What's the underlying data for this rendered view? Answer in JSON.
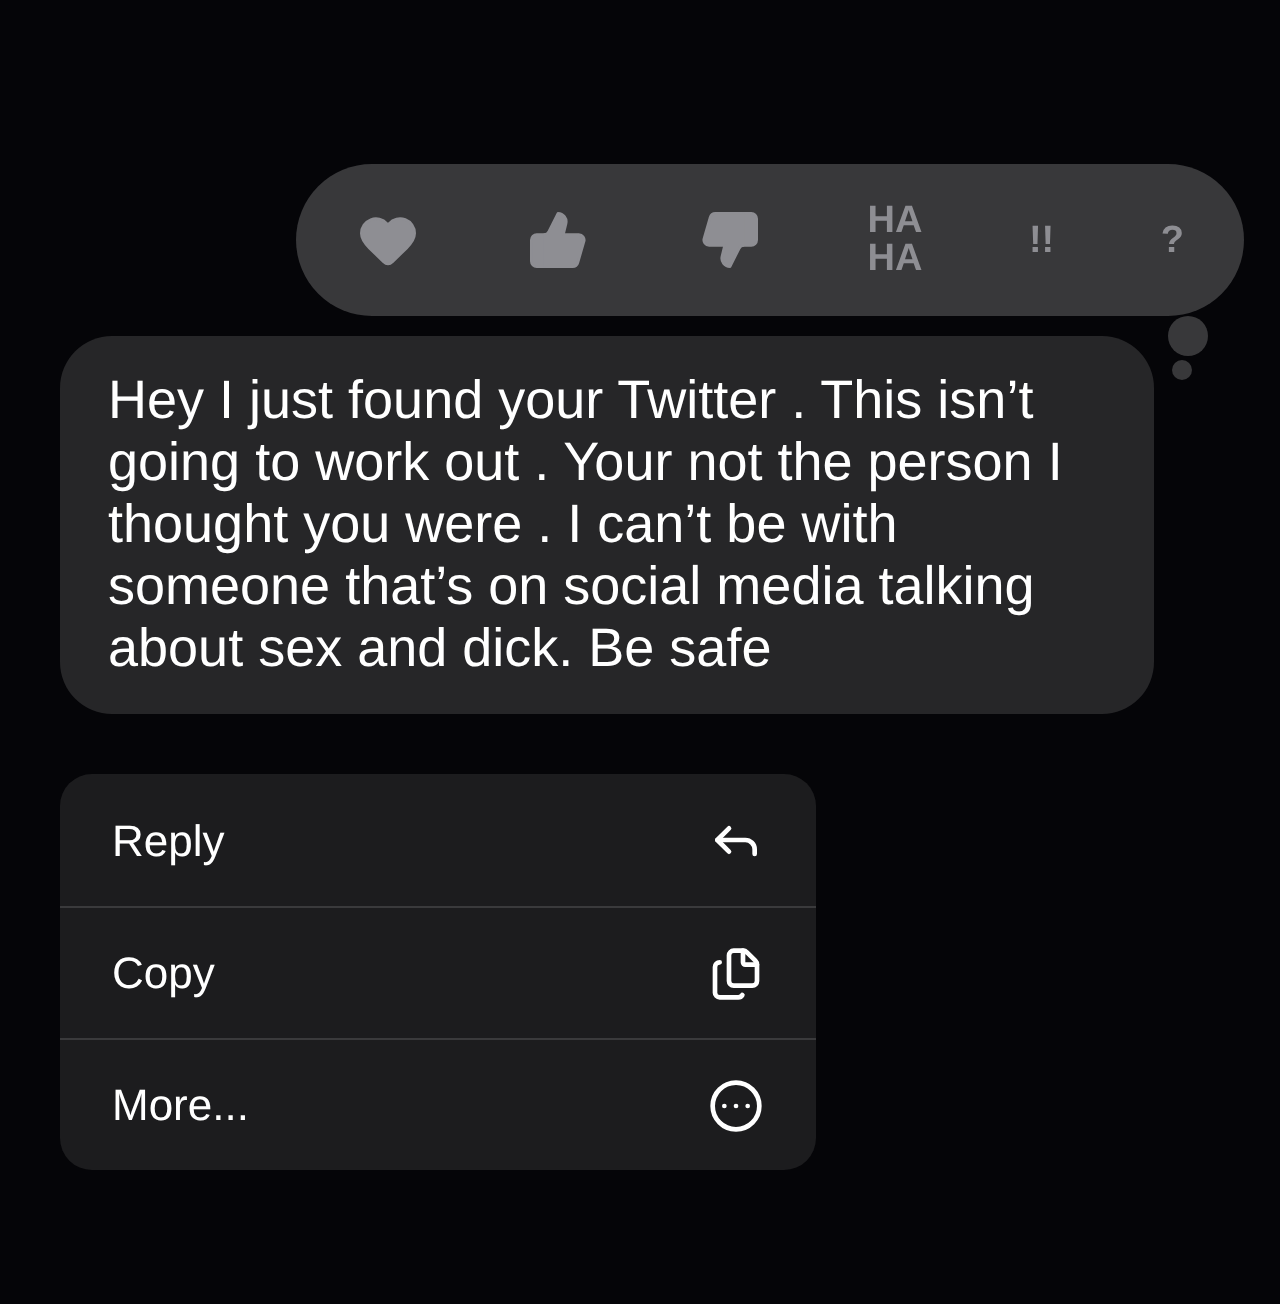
{
  "tapbacks": [
    {
      "kind": "heart"
    },
    {
      "kind": "like"
    },
    {
      "kind": "dislike"
    },
    {
      "kind": "text",
      "label": "HA\nHA"
    },
    {
      "kind": "text",
      "label": "!!"
    },
    {
      "kind": "text",
      "label": "?"
    }
  ],
  "message": {
    "text": "Hey I just found your Twitter . This isn’t going to work out . Your not the person I thought you were . I can’t be with someone that’s on social media talking about sex and dick. Be safe"
  },
  "menu": [
    {
      "label": "Reply",
      "kind": "reply"
    },
    {
      "label": "Copy",
      "kind": "copy"
    },
    {
      "label": "More...",
      "kind": "more"
    }
  ]
}
